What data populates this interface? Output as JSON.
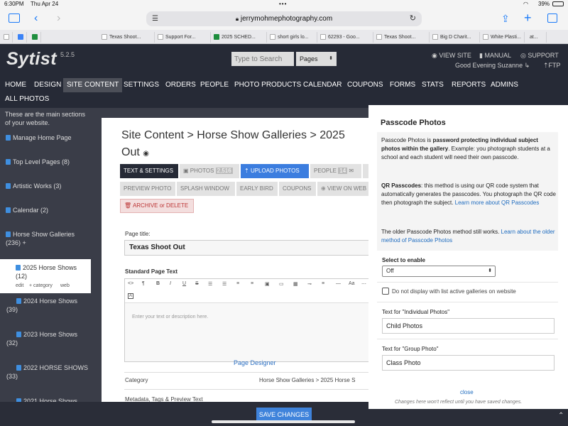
{
  "status_bar": {
    "time": "6:30PM",
    "date": "Thu Apr 24",
    "battery": "39%",
    "dots": "•••"
  },
  "browser": {
    "url": "jerrymohmephotography.com"
  },
  "tabs": [
    "Texas Shoot...",
    "Support For...",
    "2025 SCHED...",
    "short girls lo...",
    "62293 - Goo...",
    "Texas Shoot...",
    "Big D Charit...",
    "White Plasti...",
    "at..."
  ],
  "header": {
    "logo": "Sytist",
    "version": "5.2.5",
    "search_placeholder": "Type to Search",
    "pages_select": "Pages",
    "view_site": "VIEW SITE",
    "manual": "MANUAL",
    "support": "SUPPORT",
    "greeting": "Good Evening Suzanne",
    "ftp": "FTP"
  },
  "nav": {
    "items": [
      "HOME",
      "DESIGN",
      "SITE CONTENT",
      "SETTINGS",
      "ORDERS",
      "PEOPLE",
      "PHOTO PRODUCTS",
      "CALENDAR",
      "COUPONS",
      "FORMS",
      "STATS",
      "REPORTS",
      "ADMINS"
    ],
    "second_row": "ALL PHOTOS",
    "active": "SITE CONTENT"
  },
  "sidebar": {
    "intro": "These are the main sections of your website.",
    "items": [
      "Manage Home Page",
      "Top Level Pages (8)",
      "Artistic Works (3)",
      "Calendar (2)",
      "Horse Show Galleries (236) +",
      "2025 Horse Shows (12)",
      "2024 Horse Shows (39)",
      "2023 Horse Shows (32)",
      "2022 HORSE SHOWS (33)",
      "2021 Horse Shows"
    ],
    "sub_links": [
      "edit",
      "+ category",
      "web"
    ]
  },
  "main": {
    "breadcrumb": "Site Content  >  Horse Show Galleries  >  2025",
    "title_end": "Out",
    "tabs_row1": [
      "TEXT & SETTINGS",
      "PHOTOS",
      "2,516",
      "UPLOAD PHOTOS",
      "PEOPLE",
      "14"
    ],
    "tabs_row2": [
      "PREVIEW PHOTO",
      "SPLASH WINDOW",
      "EARLY BIRD",
      "COUPONS",
      "VIEW ON WEB"
    ],
    "archive": "ARCHIVE or DELETE",
    "page_title_label": "Page title:",
    "page_title_value": "Texas Shoot Out",
    "standard_text_label": "Standard Page Text",
    "editor_placeholder": "Enter your text or description here.",
    "page_designer": "Page Designer",
    "category_label": "Category",
    "category_value": "Horse Show Galleries > 2025 Horse S",
    "metadata_label": "Metadata, Tags & Preview Text",
    "save": "SAVE CHANGES"
  },
  "modal": {
    "title": "Passcode Photos",
    "p1_a": "Passcode Photos is ",
    "p1_b": "password protecting individual subject photos within the gallery",
    "p1_c": ". Example: you photograph students at a school and each student will need their own passcode.",
    "p2_a": "QR Passcodes",
    "p2_b": ": this method is using our QR code system that automatically generates the passcodes. You photograph the QR code then photograph the subject. ",
    "p2_link": "Learn more about QR Passcodes",
    "p3_a": "The older Passcode Photos method still works. ",
    "p3_link": "Learn about the older method of Passcode Photos",
    "select_label": "Select to enable",
    "select_value": "Off",
    "checkbox_label": "Do not display with list active galleries on website",
    "individual_label": "Text for \"Individual Photos\"",
    "individual_value": "Child Photos",
    "group_label": "Text for \"Group Photo\"",
    "group_value": "Class Photo",
    "close": "close",
    "note": "Changes here won't reflect until you have saved changes."
  }
}
